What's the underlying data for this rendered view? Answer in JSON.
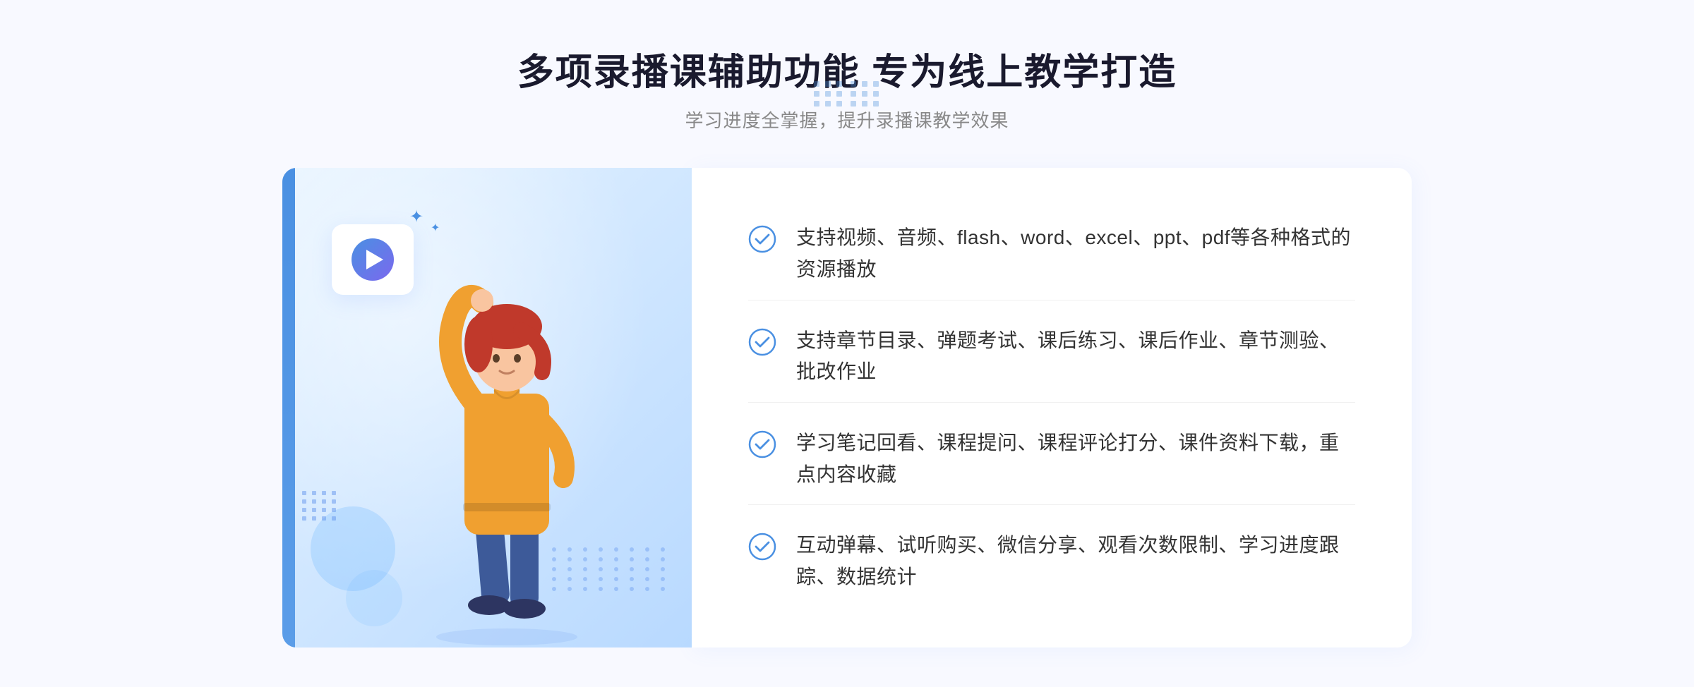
{
  "header": {
    "title": "多项录播课辅助功能 专为线上教学打造",
    "subtitle": "学习进度全掌握，提升录播课教学效果"
  },
  "features": [
    {
      "id": 1,
      "text": "支持视频、音频、flash、word、excel、ppt、pdf等各种格式的资源播放"
    },
    {
      "id": 2,
      "text": "支持章节目录、弹题考试、课后练习、课后作业、章节测验、批改作业"
    },
    {
      "id": 3,
      "text": "学习笔记回看、课程提问、课程评论打分、课件资料下载，重点内容收藏"
    },
    {
      "id": 4,
      "text": "互动弹幕、试听购买、微信分享、观看次数限制、学习进度跟踪、数据统计"
    }
  ],
  "decoration": {
    "play_button_label": "播放",
    "nav_arrow": "»"
  }
}
